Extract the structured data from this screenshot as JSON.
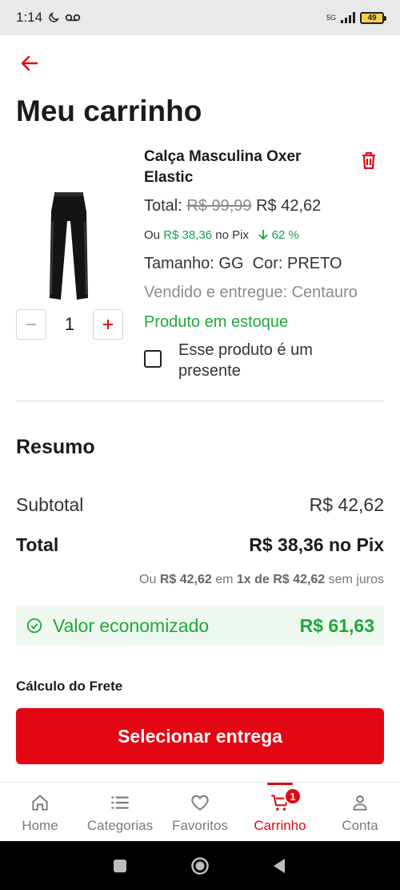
{
  "status_bar": {
    "time": "1:14",
    "network": "5G",
    "battery": "49"
  },
  "header": {
    "title": "Meu carrinho"
  },
  "product": {
    "name": "Calça Masculina Oxer Elastic",
    "total_label": "Total:",
    "old_price": "R$ 99,99",
    "price": "R$ 42,62",
    "pix_prefix": "Ou",
    "pix_price": "R$ 38,36",
    "pix_suffix": "no Pix",
    "discount": "62 %",
    "size_label": "Tamanho: GG",
    "color_label": "Cor: PRETO",
    "seller": "Vendido e entregue: Centauro",
    "stock": "Produto em estoque",
    "gift_label": "Esse produto é um presente",
    "quantity": "1"
  },
  "summary": {
    "title": "Resumo",
    "subtotal_label": "Subtotal",
    "subtotal_value": "R$ 42,62",
    "total_label": "Total",
    "total_value": "R$ 38,36 no Pix",
    "inst_ou": "Ou",
    "inst_amount": "R$ 42,62",
    "inst_em": "em",
    "inst_times": "1x de R$ 42,62",
    "inst_suffix": "sem juros",
    "savings_label": "Valor economizado",
    "savings_value": "R$ 61,63"
  },
  "freight": {
    "title": "Cálculo do Frete",
    "button": "Selecionar entrega"
  },
  "nav": {
    "items": [
      {
        "label": "Home",
        "icon": "home-icon"
      },
      {
        "label": "Categorias",
        "icon": "list-icon"
      },
      {
        "label": "Favoritos",
        "icon": "heart-icon"
      },
      {
        "label": "Carrinho",
        "icon": "cart-icon",
        "badge": "1",
        "active": true
      },
      {
        "label": "Conta",
        "icon": "user-icon"
      }
    ]
  },
  "colors": {
    "accent": "#e30613",
    "success": "#1fa83a"
  }
}
